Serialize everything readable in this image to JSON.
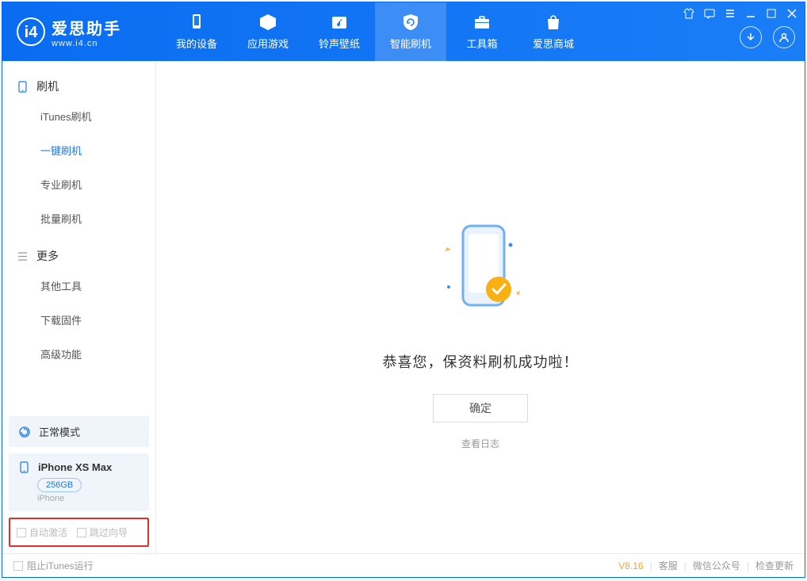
{
  "app": {
    "brand": "爱思助手",
    "url": "www.i4.cn"
  },
  "nav": {
    "my_device": "我的设备",
    "apps_games": "应用游戏",
    "ringtones": "铃声壁纸",
    "flash": "智能刷机",
    "toolbox": "工具箱",
    "store": "爱思商城"
  },
  "sidebar": {
    "flash_section": "刷机",
    "items_flash": [
      "iTunes刷机",
      "一键刷机",
      "专业刷机",
      "批量刷机"
    ],
    "more_section": "更多",
    "items_more": [
      "其他工具",
      "下载固件",
      "高级功能"
    ],
    "mode_label": "正常模式",
    "device_name": "iPhone XS Max",
    "device_storage": "256GB",
    "device_sub": "iPhone",
    "auto_activate": "自动激活",
    "skip_guide": "跳过向导"
  },
  "main": {
    "success": "恭喜您，保资料刷机成功啦！",
    "ok": "确定",
    "view_log": "查看日志"
  },
  "statusbar": {
    "block_itunes": "阻止iTunes运行",
    "version": "V8.16",
    "support": "客服",
    "wechat": "微信公众号",
    "check_update": "检查更新"
  }
}
